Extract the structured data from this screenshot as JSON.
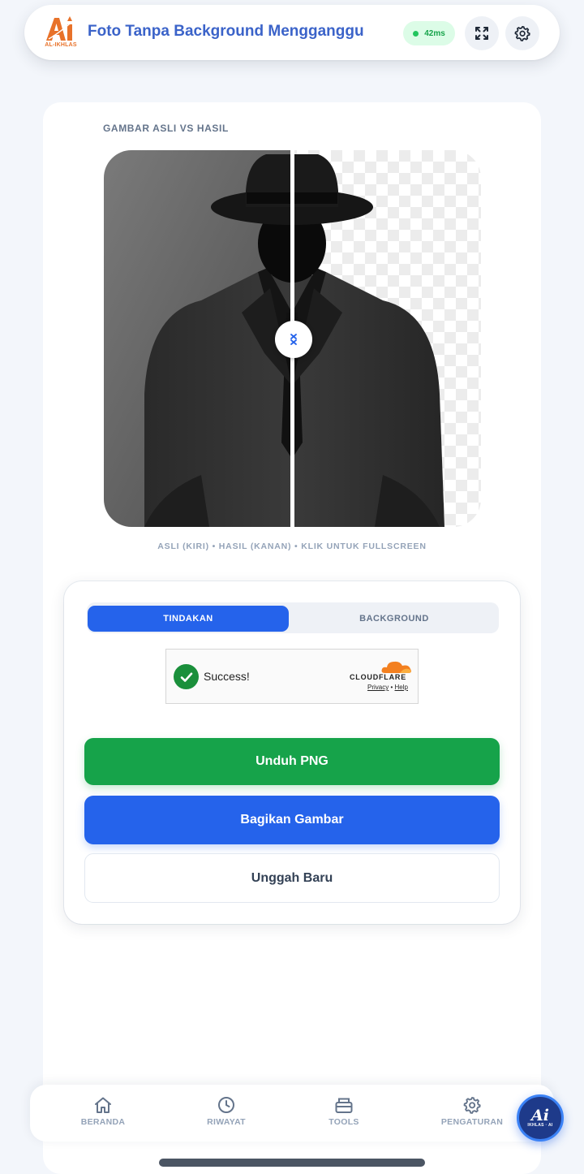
{
  "header": {
    "logo_text": "AL-IKHLAS",
    "title": "Foto Tanpa Background Mengganggu",
    "latency": "42ms",
    "fullscreen_icon": "expand-icon",
    "settings_icon": "gear-icon"
  },
  "comparison": {
    "label": "GAMBAR ASLI VS HASIL",
    "caption": "ASLI (KIRI) • HASIL (KANAN) • KLIK UNTUK FULLSCREEN",
    "handle_icon": "swap-arrows-icon"
  },
  "actions": {
    "tabs": [
      {
        "label": "TINDAKAN",
        "active": true
      },
      {
        "label": "BACKGROUND",
        "active": false
      }
    ],
    "captcha": {
      "status": "Success!",
      "brand": "CLOUDFLARE",
      "privacy": "Privacy",
      "separator": "•",
      "help": "Help"
    },
    "download_label": "Unduh PNG",
    "share_label": "Bagikan Gambar",
    "upload_label": "Unggah Baru"
  },
  "nav": {
    "items": [
      {
        "label": "BERANDA",
        "icon": "home-icon"
      },
      {
        "label": "RIWAYAT",
        "icon": "clock-icon"
      },
      {
        "label": "TOOLS",
        "icon": "toolbox-icon"
      },
      {
        "label": "PENGATURAN",
        "icon": "gear-icon"
      }
    ],
    "fab_title": "Ai",
    "fab_sub": "IKHLAS · AI"
  },
  "colors": {
    "primary": "#2563eb",
    "success": "#16a34a",
    "title": "#3b63c9",
    "logo": "#e8722a"
  }
}
